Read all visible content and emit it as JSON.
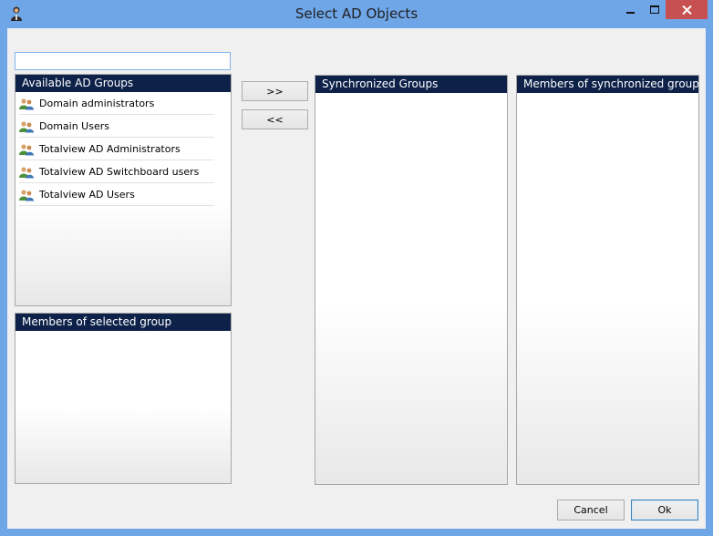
{
  "window": {
    "title": "Select AD Objects"
  },
  "search": {
    "value": "",
    "placeholder": ""
  },
  "available_groups": {
    "header": "Available AD Groups",
    "items": [
      {
        "label": "Domain administrators"
      },
      {
        "label": "Domain Users"
      },
      {
        "label": "Totalview AD Administrators"
      },
      {
        "label": "Totalview AD Switchboard users"
      },
      {
        "label": "Totalview AD Users"
      }
    ]
  },
  "members_selected": {
    "header": "Members of selected group"
  },
  "transfer": {
    "add_label": ">>",
    "remove_label": "<<"
  },
  "synchronized": {
    "header": "Synchronized Groups"
  },
  "members_synchronized": {
    "header": "Members of synchronized groups"
  },
  "footer": {
    "cancel_label": "Cancel",
    "ok_label": "Ok"
  },
  "colors": {
    "frame": "#6fa6e8",
    "header": "#0d2149",
    "close_button": "#c75050"
  }
}
